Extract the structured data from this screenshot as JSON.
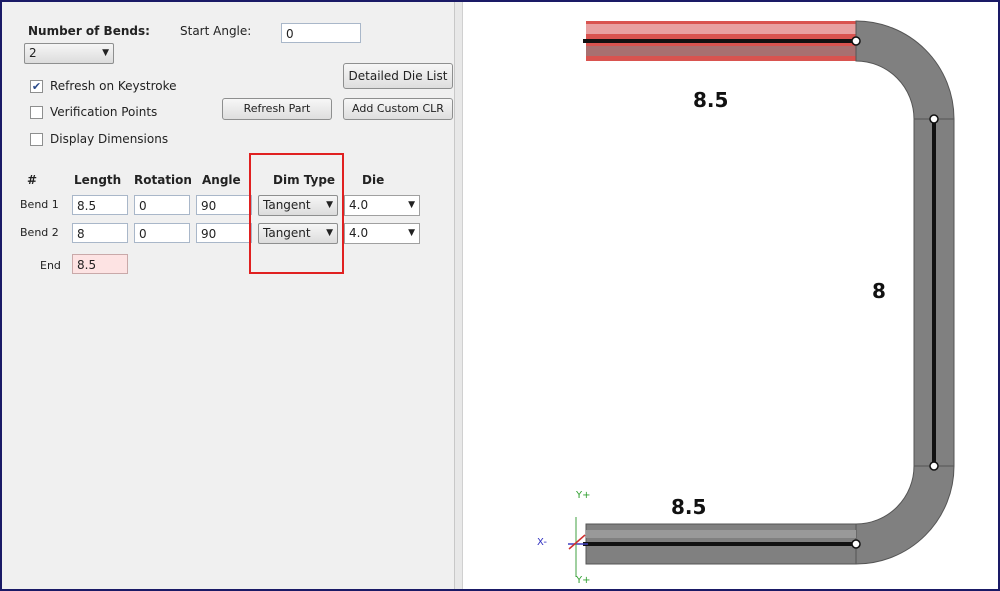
{
  "panel": {
    "number_of_bends_label": "Number of Bends:",
    "number_of_bends_value": "2",
    "start_angle_label": "Start Angle:",
    "start_angle_value": "0",
    "refresh_on_keystroke_label": "Refresh on Keystroke",
    "refresh_on_keystroke_checked": true,
    "verification_points_label": "Verification Points",
    "verification_points_checked": false,
    "display_dimensions_label": "Display Dimensions",
    "display_dimensions_checked": false,
    "detailed_die_list_label": "Detailed Die List",
    "refresh_part_label": "Refresh Part",
    "add_custom_clr_label": "Add Custom CLR"
  },
  "table": {
    "headers": [
      "#",
      "Length",
      "Rotation",
      "Angle",
      "Dim Type",
      "Die"
    ],
    "rows": [
      {
        "name": "Bend 1",
        "length": "8.5",
        "rotation": "0",
        "angle": "90",
        "dim_type": "Tangent",
        "die": "4.0"
      },
      {
        "name": "Bend 2",
        "length": "8",
        "rotation": "0",
        "angle": "90",
        "dim_type": "Tangent",
        "die": "4.0"
      }
    ],
    "end": {
      "name": "End",
      "length": "8.5"
    }
  },
  "viewport": {
    "dim_top": "8.5",
    "dim_right": "8",
    "dim_bottom": "8.5",
    "axis_y_top": "Y+",
    "axis_x": "X-",
    "axis_y_bottom": "Y+",
    "tube_color": "#808080",
    "selected_color": "#d9534f"
  }
}
